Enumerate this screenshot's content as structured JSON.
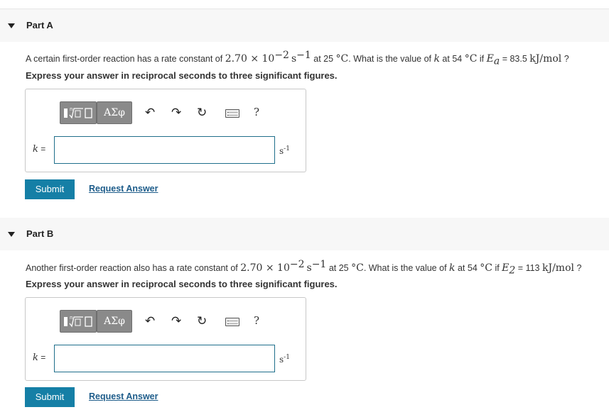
{
  "partA": {
    "title": "Part A",
    "question": {
      "t1": "A certain first-order reaction has a rate constant of ",
      "value": "2.70 × 10",
      "exp": "−2",
      "unit": "s",
      "unit_exp": "−1",
      "t2": " at 25 ",
      "deg": "°C",
      "t3": ". What is the value of ",
      "k": "k",
      "t4": " at 54 ",
      "deg2": "°C",
      "t5": " if ",
      "E": "E",
      "Esub": "a",
      "t6": " = 83.5 ",
      "eunit": "kJ/mol",
      "t7": " ?"
    },
    "instruction": "Express your answer in reciprocal seconds to three significant figures.",
    "k_label": "k =",
    "input_value": "",
    "unit_label": "s",
    "unit_exp": "-1",
    "submit_label": "Submit",
    "request_label": "Request Answer"
  },
  "partB": {
    "title": "Part B",
    "question": {
      "t1": "Another first-order reaction also has a rate constant of ",
      "value": "2.70 × 10",
      "exp": "−2",
      "unit": "s",
      "unit_exp": "−1",
      "t2": " at 25 ",
      "deg": "°C",
      "t3": ". What is the value of ",
      "k": "k",
      "t4": " at 54 ",
      "deg2": "°C",
      "t5": " if ",
      "E": "E",
      "Esub": "2",
      "t6": " = 113 ",
      "eunit": "kJ/mol",
      "t7": " ?"
    },
    "instruction": "Express your answer in reciprocal seconds to three significant figures.",
    "k_label": "k =",
    "input_value": "",
    "unit_label": "s",
    "unit_exp": "-1",
    "submit_label": "Submit",
    "request_label": "Request Answer"
  },
  "toolbar": {
    "greek_label": "ΑΣφ",
    "undo_icon": "undo-icon",
    "redo_icon": "redo-icon",
    "reset_icon": "reset-icon",
    "keyboard_icon": "keyboard-icon",
    "help_label": "?"
  },
  "colors": {
    "submit_bg": "#157fa6",
    "link": "#1d5c8a",
    "input_border": "#1f6f8b",
    "header_bg": "#f7f7f7"
  }
}
